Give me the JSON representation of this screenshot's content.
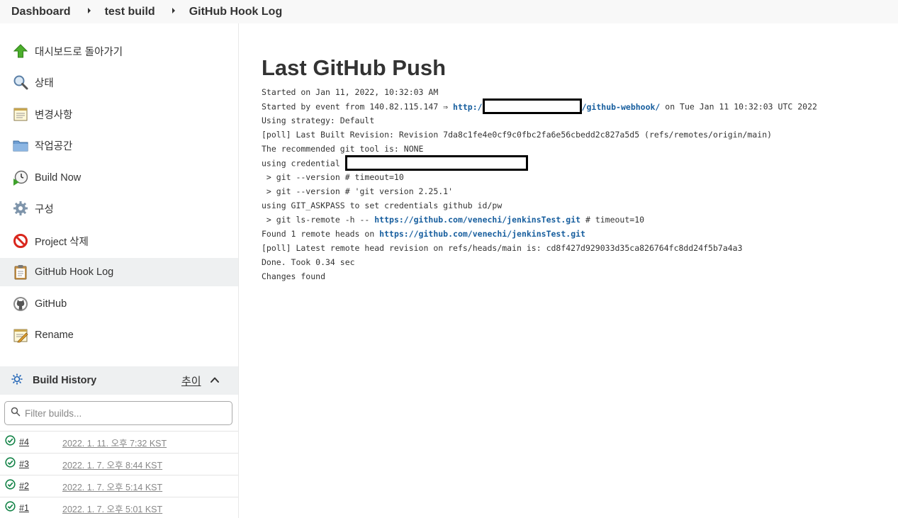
{
  "breadcrumb": {
    "items": [
      "Dashboard",
      "test build",
      "GitHub Hook Log"
    ]
  },
  "sidebar": {
    "items": [
      {
        "label": "대시보드로 돌아가기",
        "icon": "up-arrow-icon"
      },
      {
        "label": "상태",
        "icon": "magnifier-icon"
      },
      {
        "label": "변경사항",
        "icon": "notepad-icon"
      },
      {
        "label": "작업공간",
        "icon": "folder-icon"
      },
      {
        "label": "Build Now",
        "icon": "clock-play-icon"
      },
      {
        "label": "구성",
        "icon": "gear-icon"
      },
      {
        "label": "Project 삭제",
        "icon": "no-entry-icon"
      },
      {
        "label": "GitHub Hook Log",
        "icon": "clipboard-icon"
      },
      {
        "label": "GitHub",
        "icon": "github-icon"
      },
      {
        "label": "Rename",
        "icon": "notepad-pencil-icon"
      }
    ],
    "active_index": 7
  },
  "build_history": {
    "title": "Build History",
    "trend_label": "추이",
    "filter_placeholder": "Filter builds...",
    "builds": [
      {
        "number": "#4",
        "date": "2022. 1. 11. 오후 7:32 KST",
        "status": "success"
      },
      {
        "number": "#3",
        "date": "2022. 1. 7. 오후 8:44 KST",
        "status": "success"
      },
      {
        "number": "#2",
        "date": "2022. 1. 7. 오후 5:14 KST",
        "status": "success"
      },
      {
        "number": "#1",
        "date": "2022. 1. 7. 오후 5:01 KST",
        "status": "success"
      }
    ]
  },
  "main": {
    "title": "Last GitHub Push",
    "log": {
      "line1": "Started on Jan 11, 2022, 10:32:03 AM",
      "line2_prefix": "Started by event from 140.82.115.147 ⇒ ",
      "line2_link_start": "http:/",
      "line2_link_end": "/github-webhook/",
      "line2_suffix": " on Tue Jan 11 10:32:03 UTC 2022",
      "line3": "Using strategy: Default",
      "line4": "[poll] Last Built Revision: Revision 7da8c1fe4e0cf9c0fbc2fa6e56cbedd2c827a5d5 (refs/remotes/origin/main)",
      "line5": "The recommended git tool is: NONE",
      "line6_prefix": "using credential ",
      "line7": " > git --version # timeout=10",
      "line8": " > git --version # 'git version 2.25.1'",
      "line9": "using GIT_ASKPASS to set credentials github id/pw",
      "line10_prefix": " > git ls-remote -h -- ",
      "line10_link": "https://github.com/venechi/jenkinsTest.git",
      "line10_suffix": " # timeout=10",
      "line11_prefix": "Found 1 remote heads on ",
      "line11_link": "https://github.com/venechi/jenkinsTest.git",
      "line12": "[poll] Latest remote head revision on refs/heads/main is: cd8f427d929033d35ca826764fc8dd24f5b7a4a3",
      "line13": "Done. Took 0.34 sec",
      "line14": "Changes found"
    }
  },
  "colors": {
    "link": "#175e9e",
    "success": "#138347",
    "active_bg": "#eef0f1",
    "breadcrumb_bg": "#f8f8f8"
  }
}
